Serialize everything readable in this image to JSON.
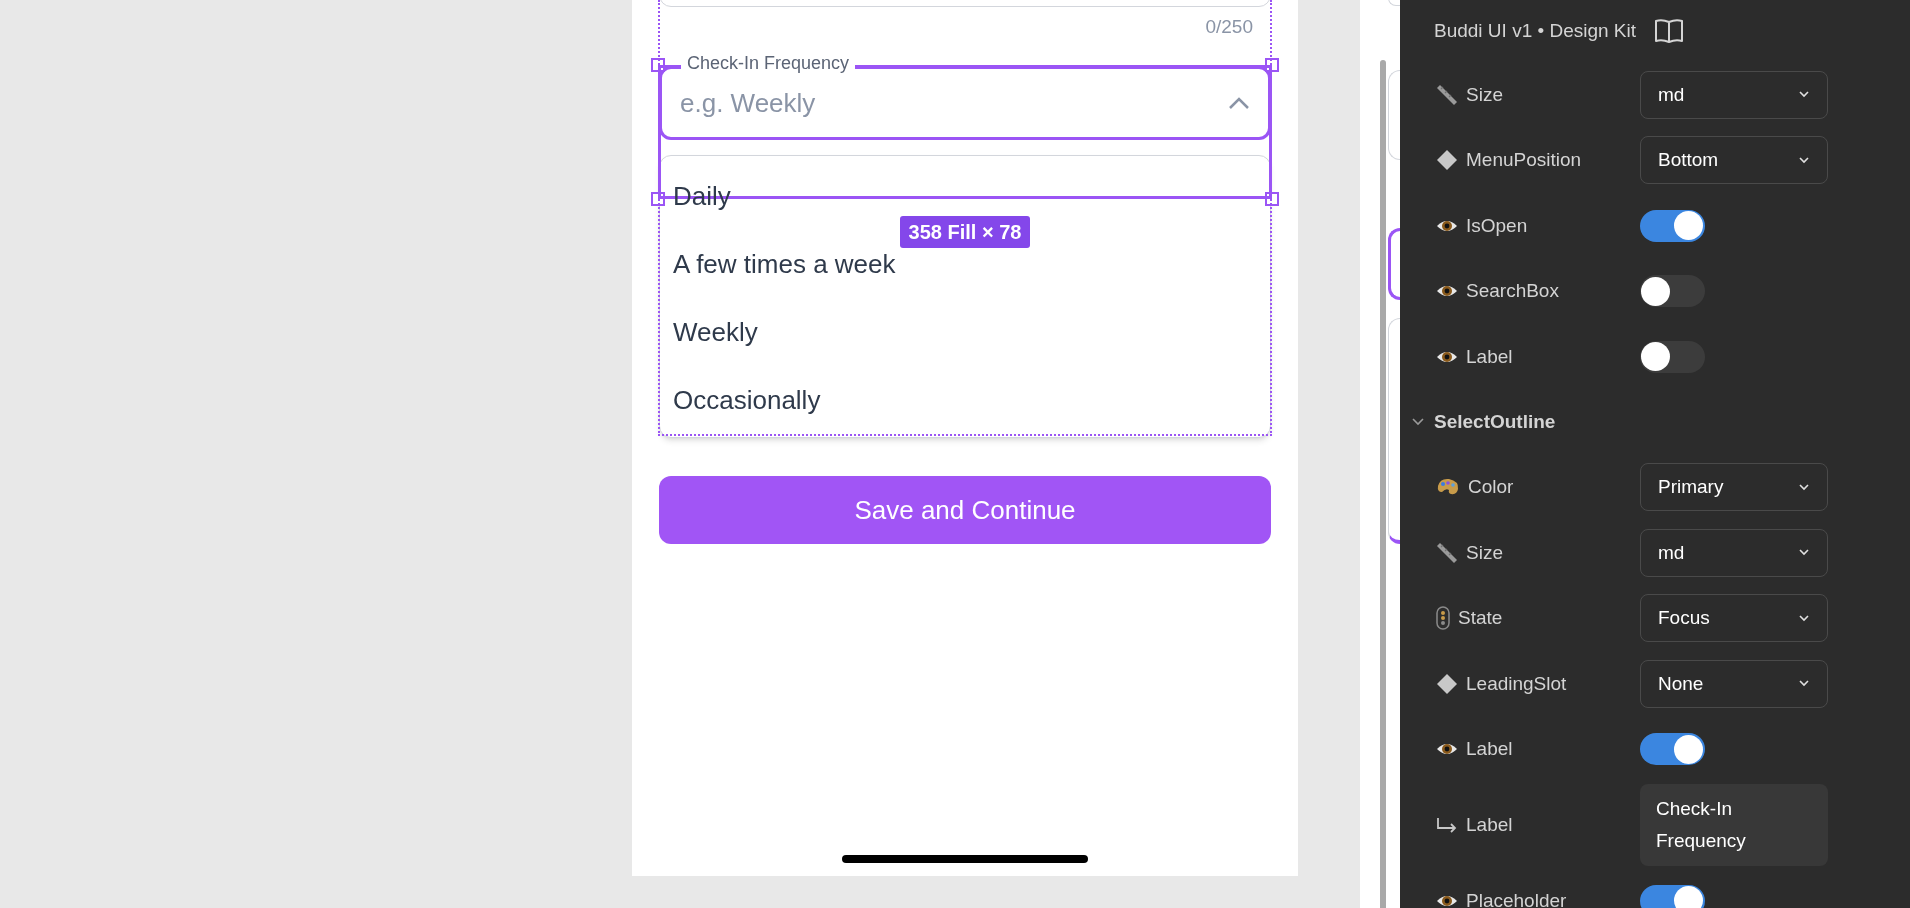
{
  "canvas": {
    "counter": "0/250",
    "select": {
      "label": "Check-In Frequency",
      "placeholder": "e.g. Weekly",
      "expanded": true
    },
    "menu_options": [
      {
        "label": "Daily"
      },
      {
        "label": "A few times a week"
      },
      {
        "label": "Weekly"
      },
      {
        "label": "Occasionally"
      }
    ],
    "selection_badge": "358 Fill × 78",
    "button": "Save and Continue"
  },
  "panel": {
    "title": "Buddi UI v1 • Design Kit",
    "properties": [
      {
        "kind": "dropdown",
        "label": "Size",
        "value": "md"
      },
      {
        "kind": "dropdown",
        "label": "MenuPosition",
        "value": "Bottom"
      },
      {
        "kind": "toggle",
        "label": "IsOpen",
        "on": true
      },
      {
        "kind": "toggle",
        "label": "SearchBox",
        "on": false
      },
      {
        "kind": "toggle",
        "label": "Label",
        "on": false
      },
      {
        "kind": "section",
        "label": "SelectOutline",
        "expanded": true
      },
      {
        "kind": "dropdown",
        "label": "Color",
        "value": "Primary"
      },
      {
        "kind": "dropdown",
        "label": "Size",
        "value": "md"
      },
      {
        "kind": "dropdown",
        "label": "State",
        "value": "Focus"
      },
      {
        "kind": "dropdown",
        "label": "LeadingSlot",
        "value": "None"
      },
      {
        "kind": "toggle",
        "label": "Label",
        "on": true
      },
      {
        "kind": "text",
        "label": "Label",
        "value": "Check-In Frequency"
      },
      {
        "kind": "toggle",
        "label": "Placeholder",
        "on": true
      }
    ]
  }
}
